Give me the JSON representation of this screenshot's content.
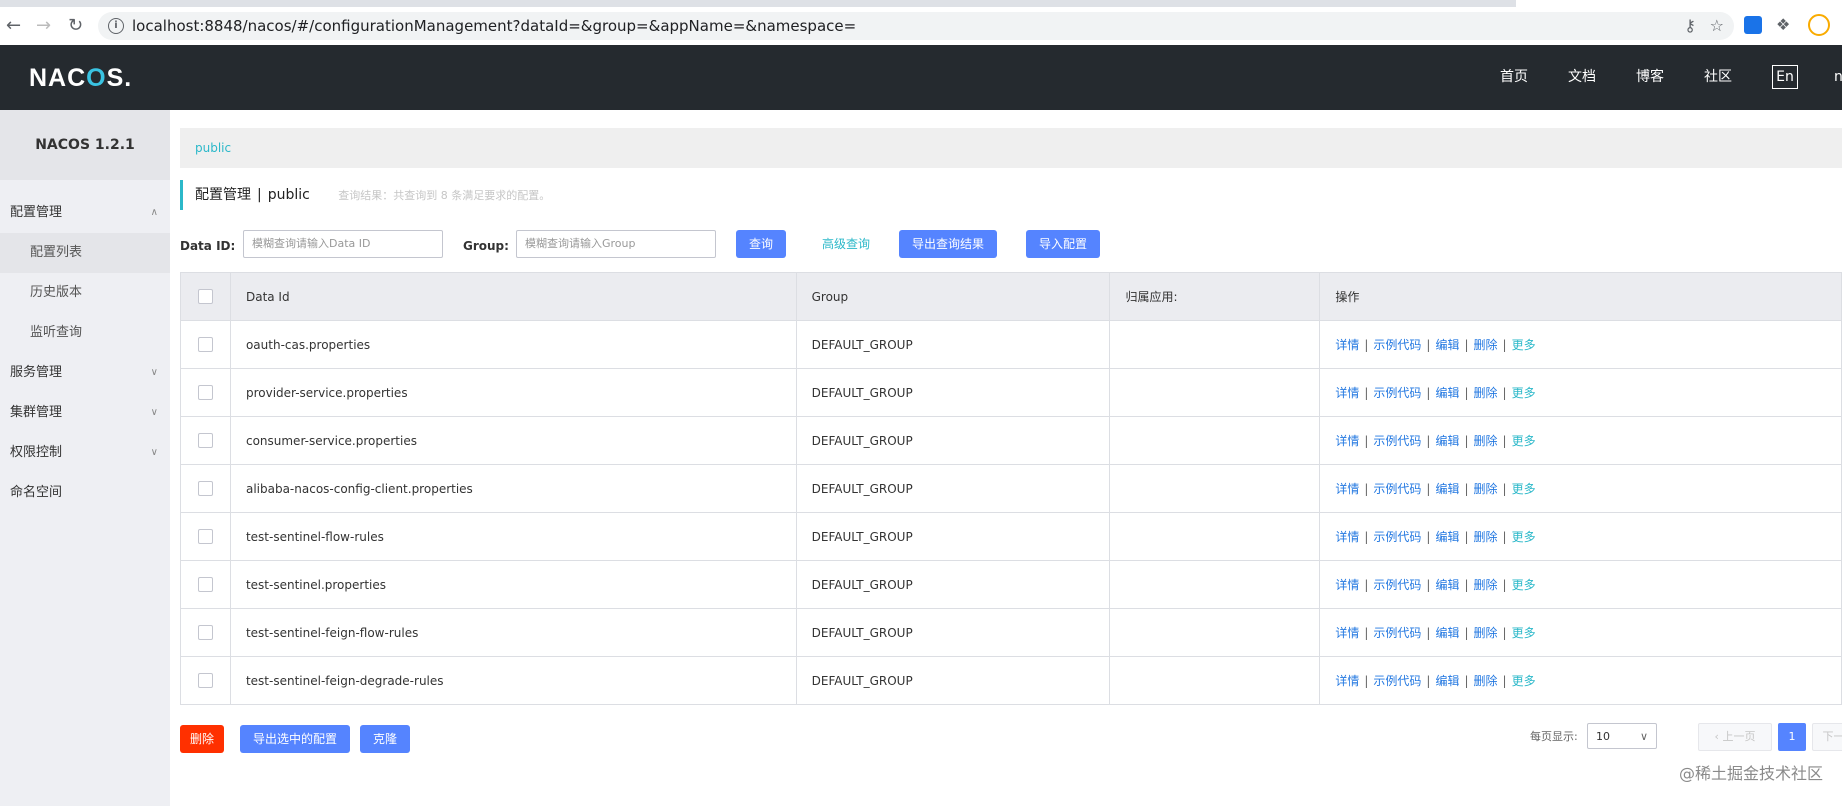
{
  "browser": {
    "url": "localhost:8848/nacos/#/configurationManagement?dataId=&group=&appName=&namespace="
  },
  "header": {
    "logo": "NACOS.",
    "nav": [
      "首页",
      "文档",
      "博客",
      "社区"
    ],
    "lang": "En",
    "user": "n"
  },
  "sidebar": {
    "title": "NACOS 1.2.1",
    "items": [
      {
        "label": "配置管理"
      },
      {
        "label": "配置列表"
      },
      {
        "label": "历史版本"
      },
      {
        "label": "监听查询"
      },
      {
        "label": "服务管理"
      },
      {
        "label": "集群管理"
      },
      {
        "label": "权限控制"
      },
      {
        "label": "命名空间"
      }
    ]
  },
  "main": {
    "namespace_tab": "public",
    "page_title": "配置管理",
    "page_sep": "|",
    "page_ns": "public",
    "result_hint": "查询结果：共查询到 8 条满足要求的配置。",
    "filters": {
      "dataid_label": "Data ID:",
      "dataid_placeholder": "模糊查询请输入Data ID",
      "group_label": "Group:",
      "group_placeholder": "模糊查询请输入Group"
    },
    "buttons": {
      "query": "查询",
      "advanced": "高级查询",
      "export_results": "导出查询结果",
      "import": "导入配置",
      "delete": "删除",
      "export_selected": "导出选中的配置",
      "clone": "克隆"
    },
    "table": {
      "columns": [
        "Data Id",
        "Group",
        "归属应用:",
        "操作"
      ],
      "ops": [
        "详情",
        "示例代码",
        "编辑",
        "删除",
        "更多"
      ],
      "rows": [
        {
          "data_id": "oauth-cas.properties",
          "group": "DEFAULT_GROUP",
          "app": ""
        },
        {
          "data_id": "provider-service.properties",
          "group": "DEFAULT_GROUP",
          "app": ""
        },
        {
          "data_id": "consumer-service.properties",
          "group": "DEFAULT_GROUP",
          "app": ""
        },
        {
          "data_id": "alibaba-nacos-config-client.properties",
          "group": "DEFAULT_GROUP",
          "app": ""
        },
        {
          "data_id": "test-sentinel-flow-rules",
          "group": "DEFAULT_GROUP",
          "app": ""
        },
        {
          "data_id": "test-sentinel.properties",
          "group": "DEFAULT_GROUP",
          "app": ""
        },
        {
          "data_id": "test-sentinel-feign-flow-rules",
          "group": "DEFAULT_GROUP",
          "app": ""
        },
        {
          "data_id": "test-sentinel-feign-degrade-rules",
          "group": "DEFAULT_GROUP",
          "app": ""
        }
      ]
    },
    "pagination": {
      "page_size_label": "每页显示:",
      "page_size": "10",
      "prev": "上一页",
      "current": "1",
      "next": "下一页"
    }
  },
  "watermark": "@稀土掘金技术社区",
  "colors": {
    "header_bg": "#252a2f",
    "accent": "#2bb8c9",
    "primary": "#5584ff",
    "danger": "#ff3000",
    "link": "#2378e1"
  }
}
